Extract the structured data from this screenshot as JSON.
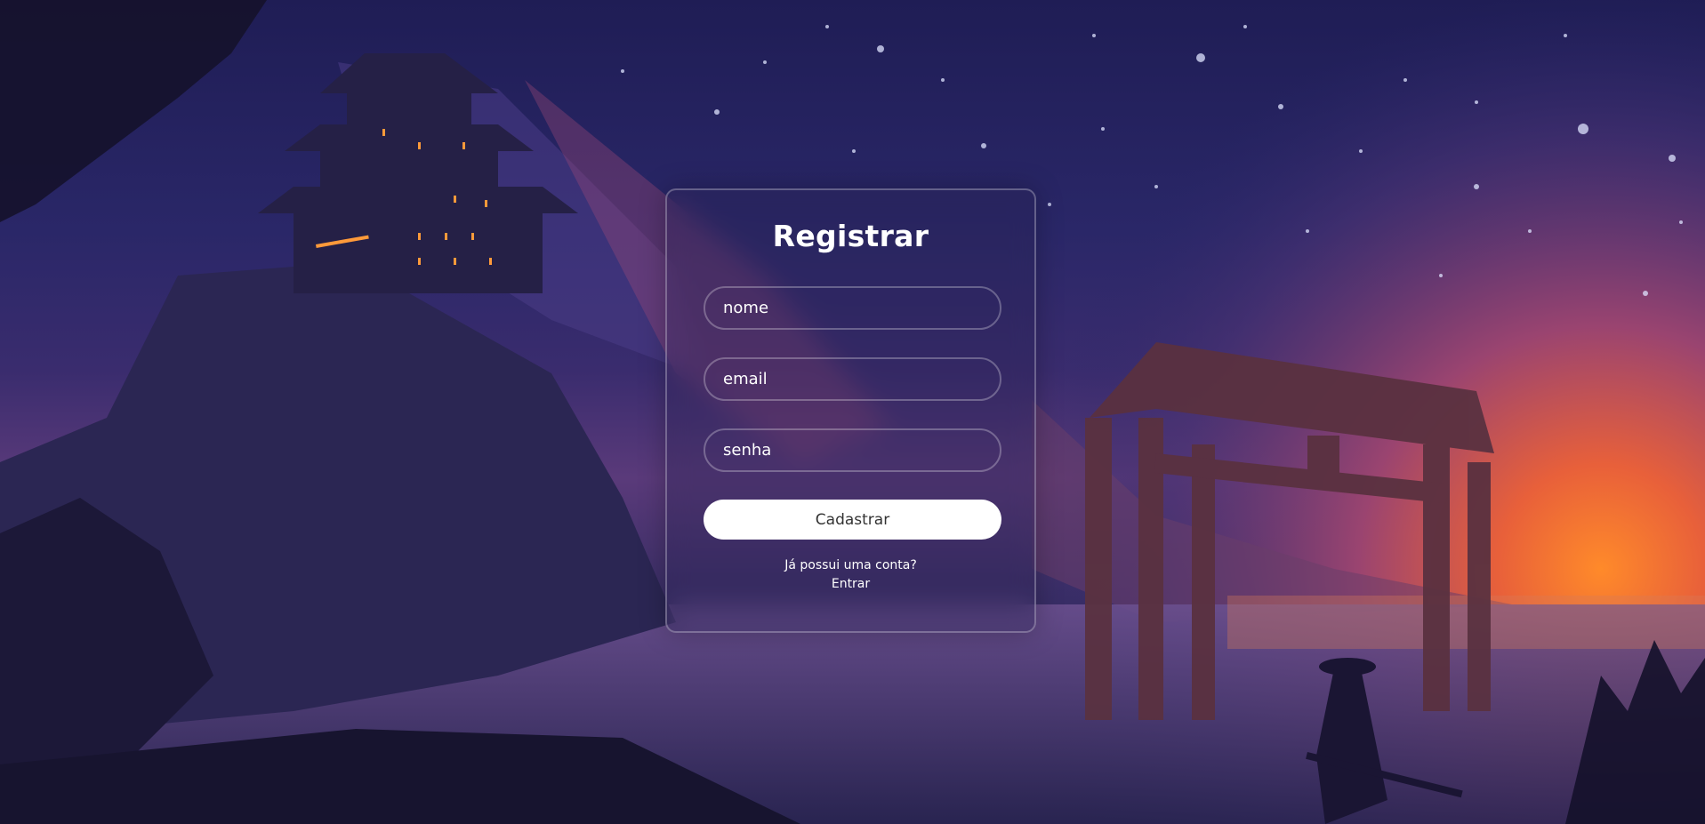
{
  "form": {
    "title": "Registrar",
    "name_placeholder": "nome",
    "email_placeholder": "email",
    "password_placeholder": "senha",
    "submit_label": "Cadastrar",
    "account_prompt": "Já possui uma conta?",
    "login_link": "Entrar"
  },
  "colors": {
    "button_bg": "#ffffff",
    "text": "#ffffff",
    "button_text": "#333333"
  }
}
